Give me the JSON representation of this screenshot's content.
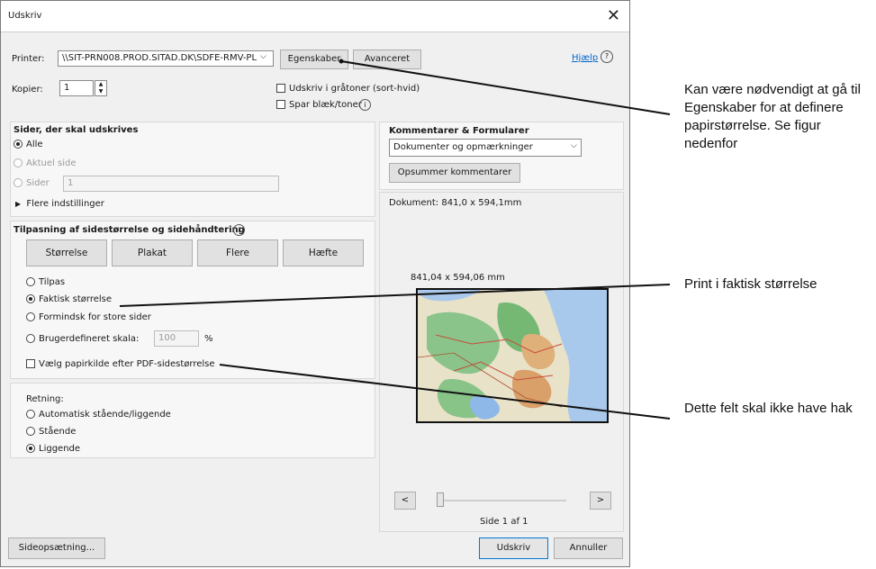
{
  "window": {
    "title": "Udskriv"
  },
  "printer": {
    "label": "Printer:",
    "value": "\\\\SIT-PRN008.PROD.SITAD.DK\\SDFE-RMV-PL",
    "properties_button": "Egenskaber",
    "advanced_button": "Avanceret",
    "help_link": "Hjælp"
  },
  "copies": {
    "label": "Kopier:",
    "value": "1"
  },
  "options": {
    "grayscale": "Udskriv i gråtoner (sort-hvid)",
    "save_ink": "Spar blæk/toner"
  },
  "pages": {
    "heading": "Sider, der skal udskrives",
    "all": "Alle",
    "current": "Aktuel side",
    "pages": "Sider",
    "pages_value": "1",
    "more": "Flere indstillinger"
  },
  "sizing": {
    "heading": "Tilpasning af sidestørrelse og sidehåndtering",
    "buttons": [
      "Størrelse",
      "Plakat",
      "Flere",
      "Hæfte"
    ],
    "fit": "Tilpas",
    "actual": "Faktisk størrelse",
    "shrink": "Formindsk for store sider",
    "custom": "Brugerdefineret skala:",
    "custom_value": "100",
    "percent": "%",
    "paper_source": "Vælg papirkilde efter PDF-sidestørrelse"
  },
  "orientation": {
    "heading": "Retning:",
    "auto": "Automatisk stående/liggende",
    "portrait": "Stående",
    "landscape": "Liggende"
  },
  "comments": {
    "heading": "Kommentarer & Formularer",
    "select_value": "Dokumenter og opmærkninger",
    "summarize_button": "Opsummer kommentarer"
  },
  "preview": {
    "document_size": "Dokument: 841,0 x 594,1mm",
    "paper_size": "841,04 x 594,06 mm",
    "prev": "<",
    "next": ">",
    "page_indicator": "Side 1 af 1"
  },
  "footer": {
    "page_setup": "Sideopsætning...",
    "print": "Udskriv",
    "cancel": "Annuller"
  },
  "annotations": {
    "a1": "Kan være nødvendigt at gå til Egenskaber for at definere papirstørrelse. Se figur nedenfor",
    "a2": "Print i faktisk størrelse",
    "a3": "Dette felt skal ikke have hak"
  }
}
